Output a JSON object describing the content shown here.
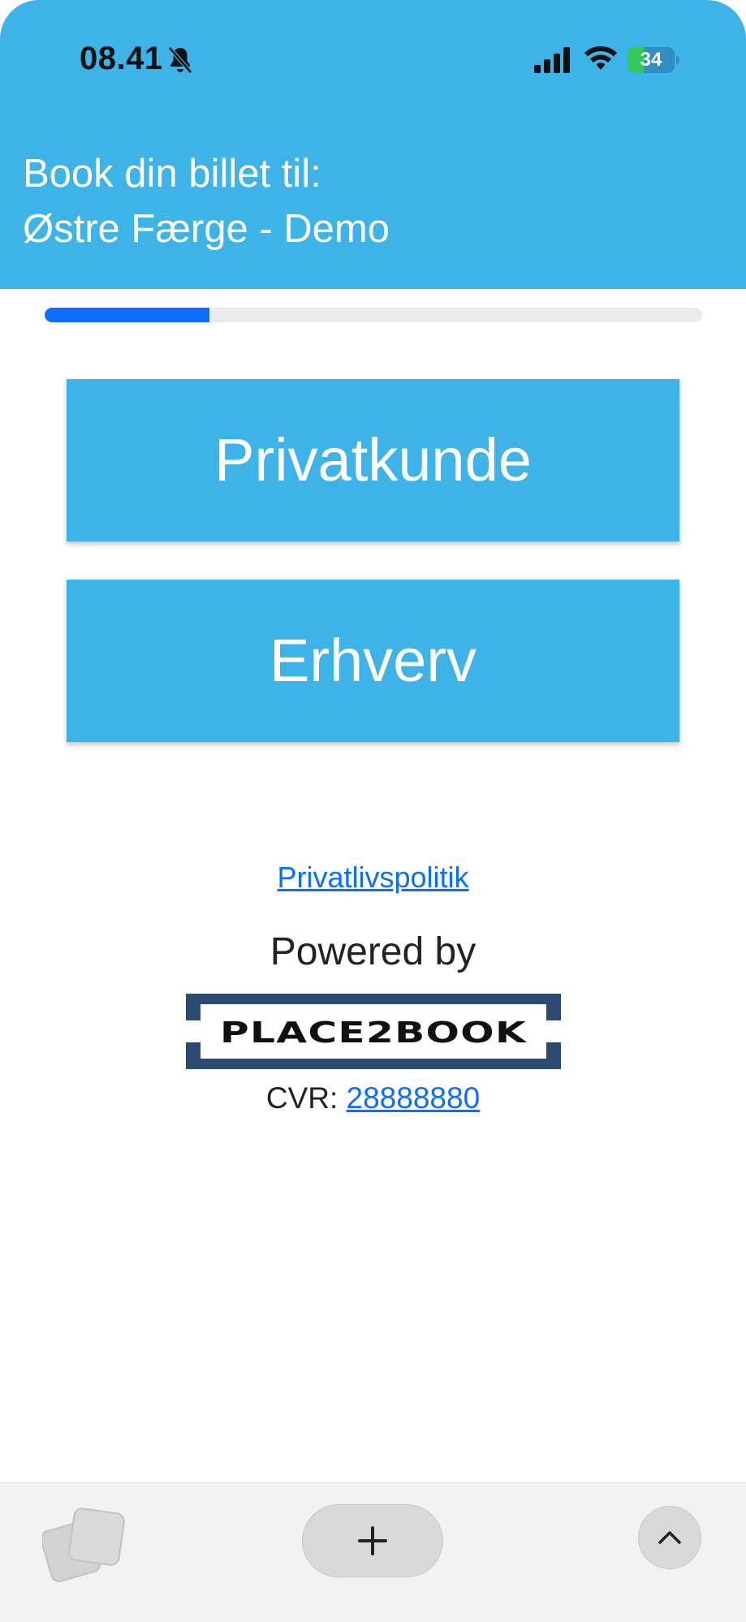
{
  "status_bar": {
    "time": "08.41",
    "battery_percent": "34",
    "battery_level": 0.34,
    "icons": [
      "bell-off-icon",
      "signal-icon",
      "wifi-icon",
      "battery-charging-icon"
    ]
  },
  "header": {
    "line1": "Book din billet til:",
    "line2": "Østre Færge - Demo"
  },
  "progress": {
    "value": 0.25
  },
  "choices": {
    "private_label": "Privatkunde",
    "business_label": "Erhverv"
  },
  "footer": {
    "privacy_link": "Privatlivspolitik",
    "powered_by": "Powered by",
    "logo_text": "PLACE2BOOK",
    "cvr_label": "CVR:",
    "cvr_number": "28888880"
  },
  "toolbar": {
    "icons": [
      "tabs-icon",
      "plus-icon",
      "chevron-up-icon"
    ]
  },
  "colors": {
    "brand": "#3db3e8",
    "progress": "#0d6efd",
    "link": "#0d6efd",
    "logo_frame": "#2c4a70"
  }
}
